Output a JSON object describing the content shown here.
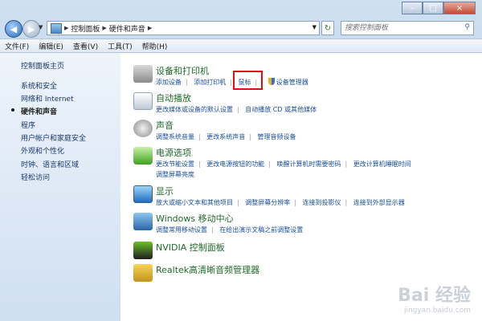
{
  "window": {
    "min_label": "–",
    "max_label": "□",
    "close_label": "×"
  },
  "address": {
    "crumbs": [
      "控制面板",
      "硬件和声音"
    ],
    "search_placeholder": "搜索控制面板"
  },
  "menu": [
    "文件(F)",
    "编辑(E)",
    "查看(V)",
    "工具(T)",
    "帮助(H)"
  ],
  "sidebar": {
    "home": "控制面板主页",
    "items": [
      "系统和安全",
      "网络和 Internet",
      "硬件和声音",
      "程序",
      "用户帐户和家庭安全",
      "外观和个性化",
      "时钟、语言和区域",
      "轻松访问"
    ],
    "active_index": 2
  },
  "groups": [
    {
      "title": "设备和打印机",
      "icon": "printer-icon",
      "links": [
        "添加设备",
        "添加打印机",
        "鼠标",
        "设备管理器"
      ]
    },
    {
      "title": "自动播放",
      "icon": "autoplay-icon",
      "links": [
        "更改媒体或设备的默认设置",
        "自动播放 CD 或其他媒体"
      ]
    },
    {
      "title": "声音",
      "icon": "speaker-icon",
      "links": [
        "调整系统音量",
        "更改系统声音",
        "管理音频设备"
      ]
    },
    {
      "title": "电源选项",
      "icon": "battery-icon",
      "links": [
        "更改节能设置",
        "更改电源按钮的功能",
        "唤醒计算机时需要密码",
        "更改计算机睡眠时间",
        "调整屏幕亮度"
      ]
    },
    {
      "title": "显示",
      "icon": "display-icon",
      "links": [
        "放大或缩小文本和其他项目",
        "调整屏幕分辨率",
        "连接到投影仪",
        "连接到外部显示器"
      ]
    },
    {
      "title": "Windows 移动中心",
      "icon": "mobility-icon",
      "links": [
        "调整常用移动设置",
        "在给出演示文稿之前调整设置"
      ]
    },
    {
      "title": "NVIDIA 控制面板",
      "icon": "nvidia-icon",
      "links": []
    },
    {
      "title": "Realtek高清晰音频管理器",
      "icon": "realtek-icon",
      "links": []
    }
  ],
  "watermark": {
    "text": "Bai 经验",
    "sub": "jingyan.baidu.com"
  },
  "colors": {
    "link": "#1a4fa0",
    "title": "#1f6a27",
    "highlight": "#e00e0e"
  }
}
